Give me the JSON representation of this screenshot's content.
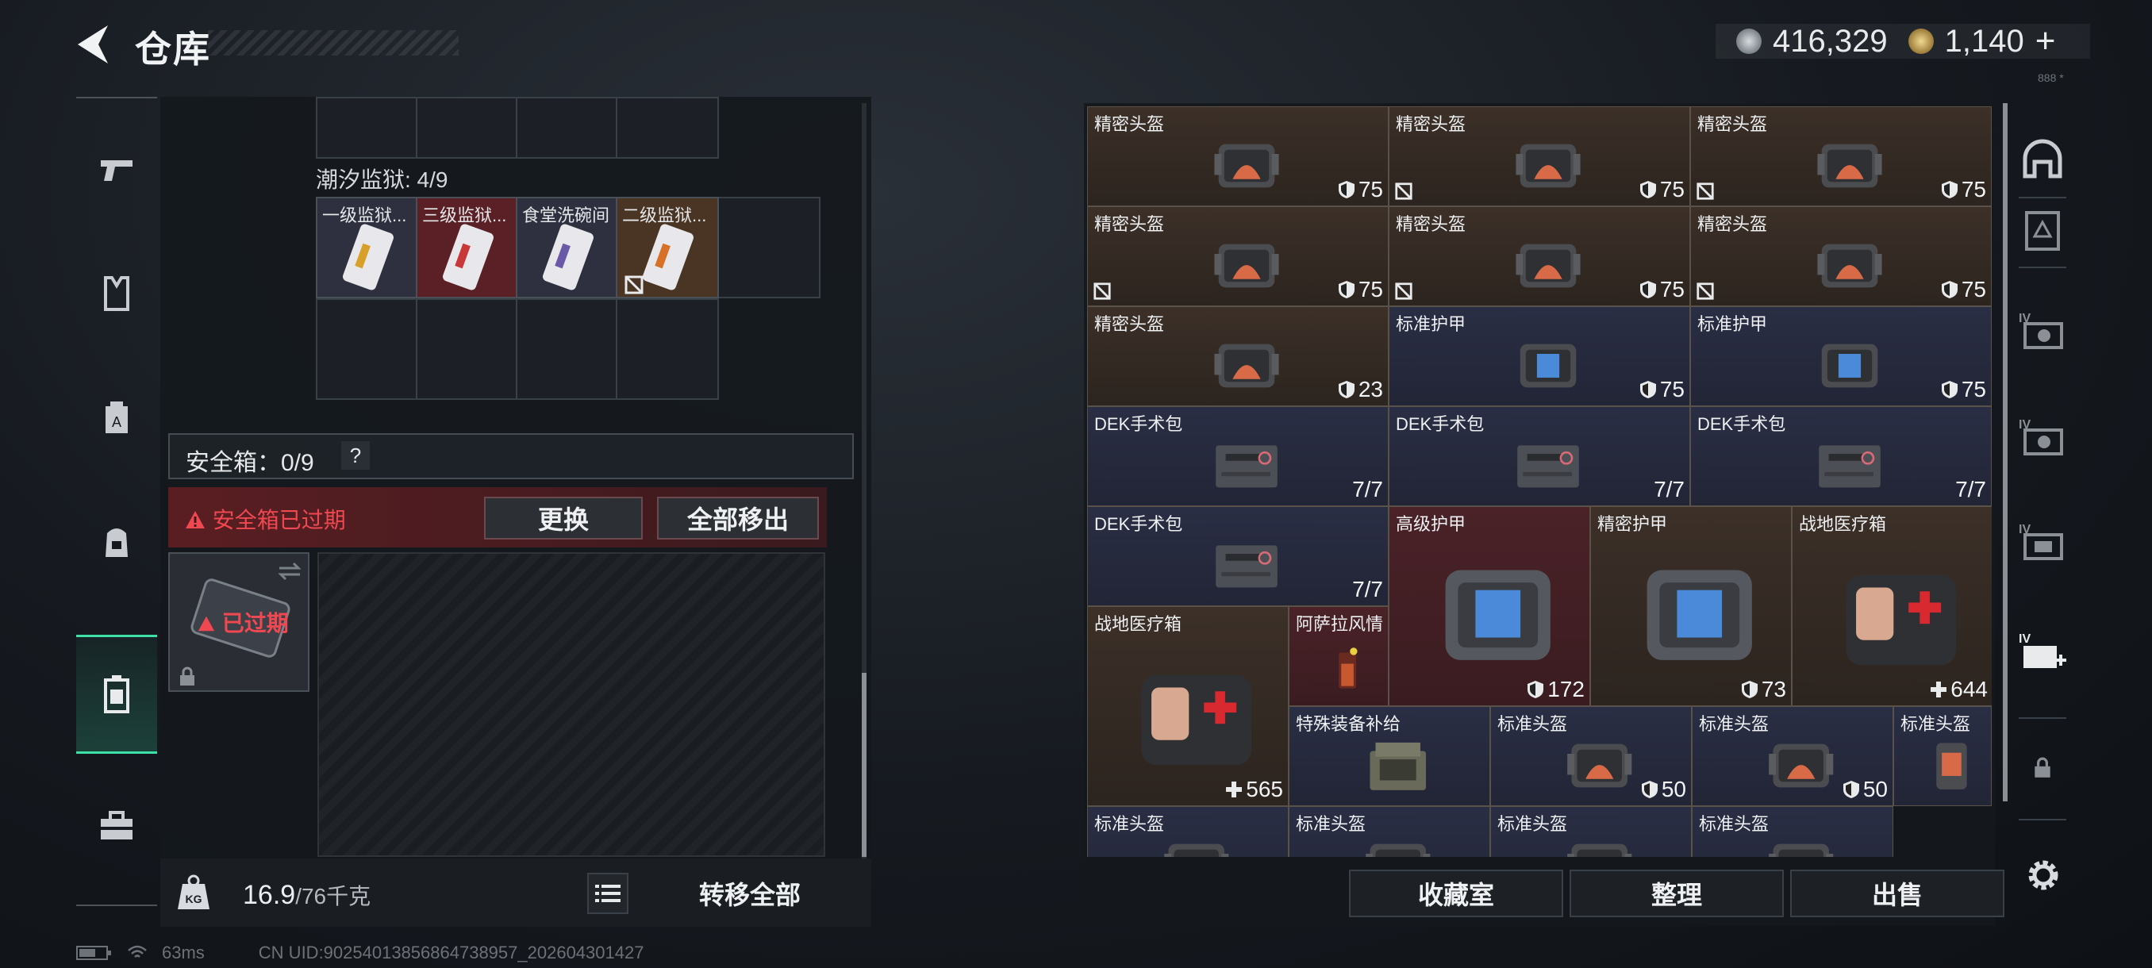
{
  "header": {
    "title": "仓库",
    "currency": [
      {
        "icon": "silver-coin-icon",
        "value": "416,329"
      },
      {
        "icon": "gold-coin-icon",
        "value": "1,140"
      }
    ],
    "add_symbol": "+"
  },
  "top_right_mark": "888 *",
  "left_rail": {
    "items": [
      {
        "name": "weapons",
        "icon": "pistol-icon"
      },
      {
        "name": "armor",
        "icon": "vest-icon"
      },
      {
        "name": "container",
        "icon": "box-icon"
      },
      {
        "name": "backpack",
        "icon": "backpack-icon"
      },
      {
        "name": "safe",
        "icon": "safe-case-icon",
        "active": true
      },
      {
        "name": "tools",
        "icon": "toolbox-icon"
      }
    ]
  },
  "left_panel": {
    "prison_label": "潮汐监狱: 4/9",
    "prison_items": [
      {
        "name": "一级监狱...",
        "color": "#2e3040"
      },
      {
        "name": "三级监狱...",
        "color": "#5a2026"
      },
      {
        "name": "食堂洗碗间",
        "color": "#2e3040"
      },
      {
        "name": "二级监狱...",
        "color": "#4a3424"
      }
    ],
    "safe_label": "安全箱：0/9",
    "safe_help": "?",
    "expired_text": "安全箱已过期",
    "btn_replace": "更换",
    "btn_move_all": "全部移出",
    "expired_label": "已过期",
    "weight_value": "16.9",
    "weight_max": "/76千克",
    "transfer_all": "转移全部"
  },
  "status_bar": {
    "ping": "63ms",
    "uid": "CN UID:9025401385686473895​7_202604301427"
  },
  "right_panel": {
    "items": [
      {
        "name": "精密头盔",
        "value": "75",
        "kind": "helmet",
        "bg": "brown",
        "mark": false
      },
      {
        "name": "精密头盔",
        "value": "75",
        "kind": "helmet",
        "bg": "brown",
        "mark": true
      },
      {
        "name": "精密头盔",
        "value": "75",
        "kind": "helmet",
        "bg": "brown",
        "mark": true
      },
      {
        "name": "精密头盔",
        "value": "75",
        "kind": "helmet",
        "bg": "brown",
        "mark": true
      },
      {
        "name": "精密头盔",
        "value": "75",
        "kind": "helmet",
        "bg": "brown",
        "mark": true
      },
      {
        "name": "精密头盔",
        "value": "75",
        "kind": "helmet",
        "bg": "brown",
        "mark": true
      },
      {
        "name": "精密头盔",
        "value": "23",
        "kind": "helmet",
        "bg": "brown",
        "mark": false
      },
      {
        "name": "标准护甲",
        "value": "75",
        "kind": "armor",
        "bg": "blue",
        "mark": false
      },
      {
        "name": "标准护甲",
        "value": "75",
        "kind": "armor",
        "bg": "blue",
        "mark": false
      },
      {
        "name": "DEK手术包",
        "value": "7/7",
        "kind": "kit",
        "bg": "blue",
        "mark": false
      },
      {
        "name": "DEK手术包",
        "value": "7/7",
        "kind": "kit",
        "bg": "blue",
        "mark": false
      },
      {
        "name": "DEK手术包",
        "value": "7/7",
        "kind": "kit",
        "bg": "blue",
        "mark": false
      },
      {
        "name": "DEK手术包",
        "value": "7/7",
        "kind": "kit",
        "bg": "blue",
        "mark": false
      },
      {
        "name": "高级护甲",
        "value": "172",
        "kind": "armor-big",
        "bg": "red",
        "mark": false
      },
      {
        "name": "精密护甲",
        "value": "73",
        "kind": "armor-big",
        "bg": "brown",
        "mark": false
      },
      {
        "name": "战地医疗箱",
        "value": "644",
        "kind": "medbox",
        "bg": "brown",
        "mark": false
      },
      {
        "name": "战地医疗箱",
        "value": "565",
        "kind": "medbox",
        "bg": "brown",
        "mark": false
      },
      {
        "name": "阿萨拉风情",
        "value": "",
        "kind": "drink",
        "bg": "red",
        "mark": false
      },
      {
        "name": "特殊装备补给",
        "value": "",
        "kind": "crate",
        "bg": "blue",
        "mark": false
      },
      {
        "name": "标准头盔",
        "value": "50",
        "kind": "helmet",
        "bg": "blue",
        "mark": false
      },
      {
        "name": "标准头盔",
        "value": "50",
        "kind": "helmet",
        "bg": "blue",
        "mark": false
      },
      {
        "name": "标准头盔",
        "value": "",
        "kind": "bag",
        "bg": "blue",
        "mark": false
      },
      {
        "name": "标准头盔",
        "value": "",
        "kind": "helmet",
        "bg": "blue",
        "mark": false
      },
      {
        "name": "标准头盔",
        "value": "",
        "kind": "helmet",
        "bg": "blue",
        "mark": false
      },
      {
        "name": "标准头盔",
        "value": "",
        "kind": "helmet",
        "bg": "blue",
        "mark": false
      },
      {
        "name": "标准头盔",
        "value": "",
        "kind": "helmet",
        "bg": "blue",
        "mark": false
      }
    ],
    "buttons": {
      "collection": "收藏室",
      "sort": "整理",
      "sell": "出售"
    }
  },
  "right_rail": {
    "items": [
      {
        "icon": "helmet-slot-icon"
      },
      {
        "icon": "tactical-slot-icon"
      },
      {
        "icon": "tier-iv-slot-icon",
        "label": "IV"
      },
      {
        "icon": "tier-iv-slot-icon",
        "label": "IV"
      },
      {
        "icon": "tier-iv-slot-icon",
        "label": "IV"
      },
      {
        "icon": "tier-iv-med-slot-icon",
        "label": "IV"
      },
      {
        "icon": "lock-icon"
      }
    ]
  }
}
